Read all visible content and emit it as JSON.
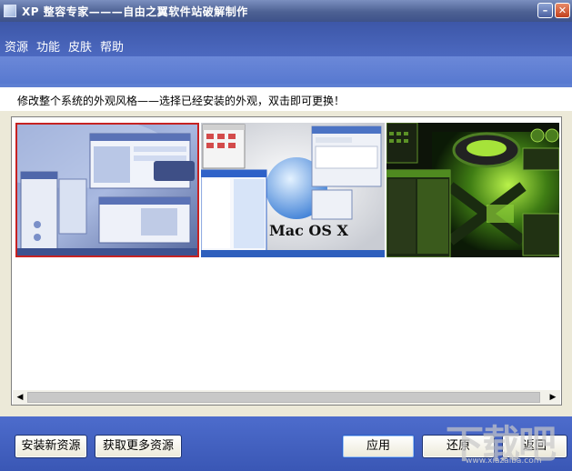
{
  "window": {
    "title": "XP 整容专家———自由之翼软件站破解制作",
    "minimize_glyph": "–",
    "close_glyph": "✕"
  },
  "menu": {
    "items": [
      {
        "label": "资源"
      },
      {
        "label": "功能"
      },
      {
        "label": "皮肤"
      },
      {
        "label": "帮助"
      }
    ]
  },
  "instruction_text": "修改整个系统的外观风格——选择已经安装的外观，双击即可更换！",
  "themes": [
    {
      "name": "blue-theme",
      "selected": true
    },
    {
      "name": "mac-os-x-theme",
      "caption": "Mac OS X",
      "selected": false
    },
    {
      "name": "green-xbox-theme",
      "selected": false
    }
  ],
  "scrollbar": {
    "left_arrow": "◀",
    "right_arrow": "▶"
  },
  "buttons": {
    "install_new": "安装新资源",
    "get_more": "获取更多资源",
    "apply": "应用",
    "restore": "还原",
    "back": "返回"
  },
  "colors": {
    "titlebar": "#4d6193",
    "menubar": "#3d57a8",
    "banner": "#6b88d8",
    "footer": "#4d6ccc",
    "selection_border": "#c62222"
  },
  "watermark": {
    "text": "下载吧",
    "url": "www.xiazaiba.com"
  }
}
